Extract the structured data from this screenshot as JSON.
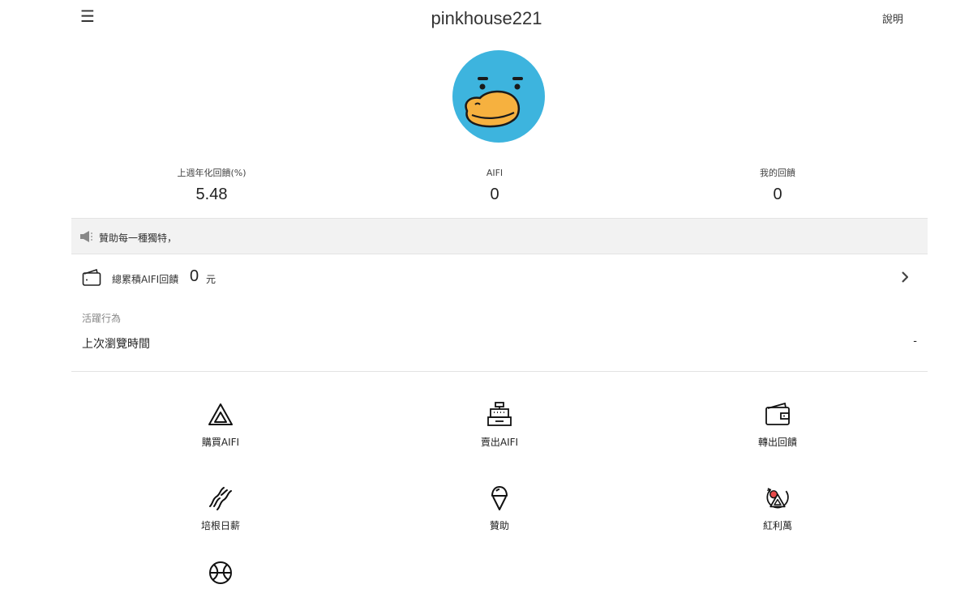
{
  "header": {
    "menu_icon": "hamburger-icon",
    "title": "pinkhouse221",
    "help_label": "說明"
  },
  "avatar": {
    "icon": "duck-avatar",
    "bg_color": "#3db4de"
  },
  "stats": [
    {
      "label": "上週年化回饋(%)",
      "value": "5.48"
    },
    {
      "label": "AIFI",
      "value": "0"
    },
    {
      "label": "我的回饋",
      "value": "0"
    }
  ],
  "announcement": {
    "icon": "speaker-icon",
    "text": "贊助每一種獨特，"
  },
  "cumulative": {
    "icon": "wallet-icon",
    "label": "總累積AIFI回饋",
    "amount": "0",
    "unit": "元",
    "chevron_icon": "chevron-right-icon"
  },
  "activity": {
    "section_label": "活躍行為",
    "last_browse_label": "上次瀏覽時間",
    "last_browse_value": "-"
  },
  "actions": [
    {
      "label": "購買AIFI",
      "icon": "aifi-logo-icon"
    },
    {
      "label": "賣出AIFI",
      "icon": "cash-register-icon"
    },
    {
      "label": "轉出回饋",
      "icon": "wallet-icon"
    },
    {
      "label": "培根日薪",
      "icon": "bacon-icon"
    },
    {
      "label": "贊助",
      "icon": "ice-cream-icon"
    },
    {
      "label": "紅利萬",
      "icon": "bonus-icon"
    },
    {
      "label": "",
      "icon": "ball-icon"
    }
  ]
}
